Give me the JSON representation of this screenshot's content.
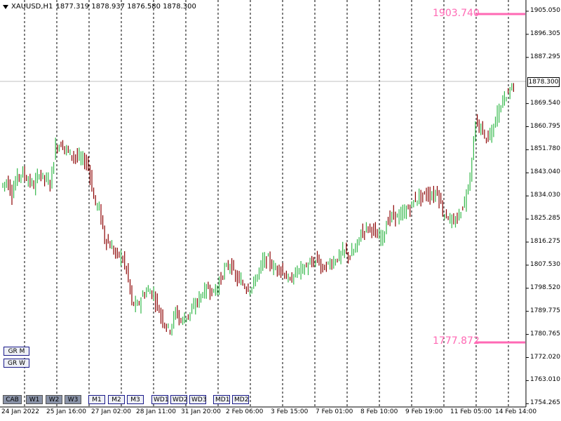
{
  "header": {
    "symbol_info": "XAUUSD,H1",
    "ohlc": "1877.319 1878.937 1876.580 1878.300"
  },
  "price_axis": [
    "1905.050",
    "1896.305",
    "1887.295",
    "1878.300",
    "1869.540",
    "1860.795",
    "1851.780",
    "1843.040",
    "1834.030",
    "1825.285",
    "1816.275",
    "1807.530",
    "1798.520",
    "1789.775",
    "1780.765",
    "1772.020",
    "1763.010",
    "1754.265"
  ],
  "current_price": "1878.300",
  "levels": {
    "upper": "1903.740",
    "lower": "1777.872"
  },
  "time_axis": [
    "24 Jan 2022",
    "25 Jan 16:00",
    "27 Jan 02:00",
    "28 Jan 11:00",
    "31 Jan 20:00",
    "2 Feb 06:00",
    "3 Feb 15:00",
    "7 Feb 01:00",
    "8 Feb 10:00",
    "9 Feb 19:00",
    "11 Feb 05:00",
    "14 Feb 14:00"
  ],
  "buttons_left": [
    "GR M",
    "GR W"
  ],
  "buttons_bottom": [
    "CAB",
    "W1",
    "W2",
    "W3",
    "M1",
    "M2",
    "M3",
    "WD1",
    "WD2",
    "WD3",
    "MD1",
    "MD2"
  ],
  "colors": {
    "bull": "#33b84a",
    "bear": "#8b0000",
    "level": "#ff69b4",
    "grid": "#000000"
  },
  "chart_data": {
    "type": "line",
    "xlabel": "",
    "ylabel": "",
    "ylim": [
      1754.265,
      1905.05
    ],
    "series": [
      {
        "values": [
          1838,
          1840,
          1835,
          1842,
          1843,
          1840,
          1838,
          1843,
          1841,
          1839,
          1853,
          1854,
          1852,
          1850,
          1849,
          1848,
          1846,
          1833,
          1829,
          1818,
          1815,
          1812,
          1811,
          1806,
          1793,
          1792,
          1796,
          1798,
          1796,
          1790,
          1785,
          1783,
          1790,
          1786,
          1788,
          1790,
          1794,
          1797,
          1799,
          1797,
          1801,
          1806,
          1808,
          1803,
          1801,
          1799,
          1799,
          1804,
          1809,
          1810,
          1806,
          1807,
          1804,
          1801,
          1805,
          1806,
          1807,
          1808,
          1810,
          1806,
          1808,
          1809,
          1811,
          1813,
          1811,
          1814,
          1820,
          1822,
          1822,
          1818,
          1819,
          1825,
          1827,
          1826,
          1828,
          1830,
          1833,
          1834,
          1835,
          1834,
          1836,
          1828,
          1826,
          1823,
          1827,
          1832,
          1842,
          1862,
          1860,
          1856,
          1858,
          1866,
          1871,
          1874,
          1878
        ]
      }
    ]
  }
}
